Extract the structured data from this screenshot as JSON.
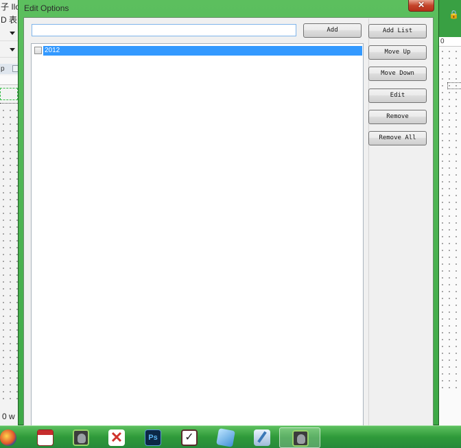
{
  "background_app": {
    "menu_row_1": "子 Ilo",
    "menu_row_2": "D 表",
    "tab_fragment": "p",
    "ruler_fragment": "0",
    "status_text": "0  w"
  },
  "dialog": {
    "title": "Edit Options",
    "close_glyph": "✕",
    "input": {
      "value": "",
      "placeholder": ""
    },
    "buttons": {
      "add": "Add",
      "add_list": "Add List",
      "move_up": "Move Up",
      "move_down": "Move Down",
      "edit": "Edit",
      "remove": "Remove",
      "remove_all": "Remove All"
    },
    "list_items": [
      {
        "label": "2012",
        "checked": false,
        "selected": true
      }
    ]
  },
  "taskbar": {
    "icons": [
      "firefox-icon",
      "calendar-icon",
      "evernote-icon",
      "xmind-icon",
      "photoshop-icon",
      "checklist-icon",
      "cube-icon",
      "pen-icon",
      "evernote-icon"
    ],
    "ps_label": "Ps",
    "x_label": "✕",
    "check_label": "✓",
    "active_index": 8
  },
  "colors": {
    "selection": "#3399ff",
    "window_frame": "#4db352",
    "taskbar": "#2f9a3a"
  }
}
